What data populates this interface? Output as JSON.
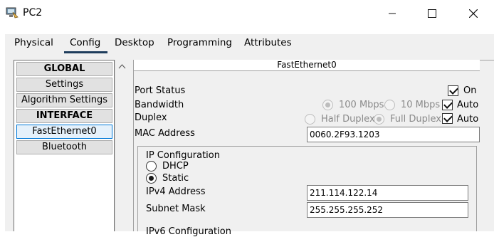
{
  "window": {
    "title": "PC2",
    "icon": "pc-icon"
  },
  "tabs": [
    {
      "label": "Physical",
      "active": false
    },
    {
      "label": "Config",
      "active": true
    },
    {
      "label": "Desktop",
      "active": false
    },
    {
      "label": "Programming",
      "active": false
    },
    {
      "label": "Attributes",
      "active": false
    }
  ],
  "sidebar": {
    "items": [
      {
        "label": "GLOBAL",
        "type": "header"
      },
      {
        "label": "Settings",
        "type": "item"
      },
      {
        "label": "Algorithm Settings",
        "type": "item"
      },
      {
        "label": "INTERFACE",
        "type": "header"
      },
      {
        "label": "FastEthernet0",
        "type": "item",
        "selected": true
      },
      {
        "label": "Bluetooth",
        "type": "item"
      }
    ]
  },
  "panel": {
    "title": "FastEthernet0",
    "port_status": {
      "label": "Port Status",
      "on_label": "On",
      "checked": true
    },
    "bandwidth": {
      "label": "Bandwidth",
      "options": [
        "100 Mbps",
        "10 Mbps"
      ],
      "selected": "100 Mbps",
      "auto_label": "Auto",
      "auto_checked": true
    },
    "duplex": {
      "label": "Duplex",
      "options": [
        "Half Duplex",
        "Full Duplex"
      ],
      "selected": "Full Duplex",
      "auto_label": "Auto",
      "auto_checked": true
    },
    "mac": {
      "label": "MAC Address",
      "value": "0060.2F93.1203"
    },
    "ip_config": {
      "title": "IP Configuration",
      "dhcp_label": "DHCP",
      "static_label": "Static",
      "mode": "Static",
      "ipv4_label": "IPv4 Address",
      "ipv4_value": "211.114.122.14",
      "mask_label": "Subnet Mask",
      "mask_value": "255.255.255.252"
    },
    "next_section": "IPv6 Configuration"
  },
  "colors": {
    "tab_underline": "#1f3d5c",
    "selected_border": "#0078d7"
  }
}
